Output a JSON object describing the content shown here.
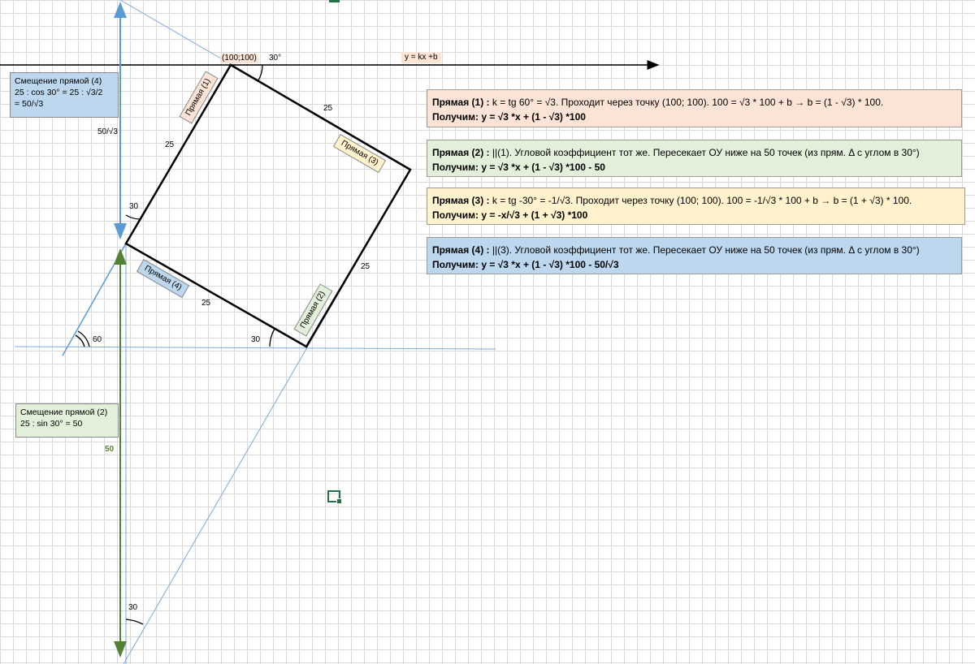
{
  "axis": {
    "point_label": "(100;100)",
    "angle_label": "30°",
    "equation_label": "y = kx +b"
  },
  "square": {
    "side_labels": [
      "25",
      "25",
      "25",
      "25"
    ],
    "line_tags": {
      "line1": "Прямая (1)",
      "line2": "Прямая (2)",
      "line3": "Прямая (3)",
      "line4": "Прямая (4)"
    }
  },
  "angles": {
    "left_vertex": "30",
    "bottom_vertex": "30",
    "ray": "60",
    "bottom_arrow": "30"
  },
  "offsets": {
    "upper": "50/√3",
    "lower": "50"
  },
  "notes": {
    "shift4": {
      "line1": "Смещение прямой (4)",
      "line2": "25 : cos 30° = 25 : √3/2",
      "line3": "= 50/√3"
    },
    "shift2": {
      "line1": "Смещение прямой (2)",
      "line2": "25 : sin 30° = 50"
    }
  },
  "equations": [
    {
      "title": "Прямая (1) :",
      "text": "  k = tg 60° =  √3. Проходит через точку (100; 100). 100 = √3 * 100 + b → b = (1 - √3) * 100.",
      "result": "Получим: y = √3 *x + (1 - √3) *100"
    },
    {
      "title": "Прямая (2) :",
      "text": " ||(1). Угловой коэффициент тот же. Пересекает ОУ ниже на 50 точек (из прям. Δ с углом в 30°)",
      "result": "Получим: y = √3 *x + (1 - √3) *100  - 50"
    },
    {
      "title": "Прямая (3) :",
      "text": "  k = tg -30° =  -1/√3. Проходит через точку (100; 100). 100 = -1/√3 * 100 + b → b = (1 + √3) * 100.",
      "result": "Получим: y = -x/√3  + (1 + √3) *100"
    },
    {
      "title": "Прямая (4) :",
      "text": " ||(3). Угловой коэффициент тот же. Пересекает ОУ ниже на 50 точек (из прям. Δ с углом в 30°)",
      "result": "Получим: y = √3 *x + (1 - √3) *100  - 50/√3"
    }
  ],
  "colors": {
    "line": "#000000",
    "helper": "#5b9bd5",
    "arrow_blue": "#5b9bd5",
    "arrow_green": "#548235",
    "tag1": "#fbe4d5",
    "tag2": "#e2efd9",
    "tag3": "#fff2cc",
    "tag4": "#bdd7ee"
  }
}
